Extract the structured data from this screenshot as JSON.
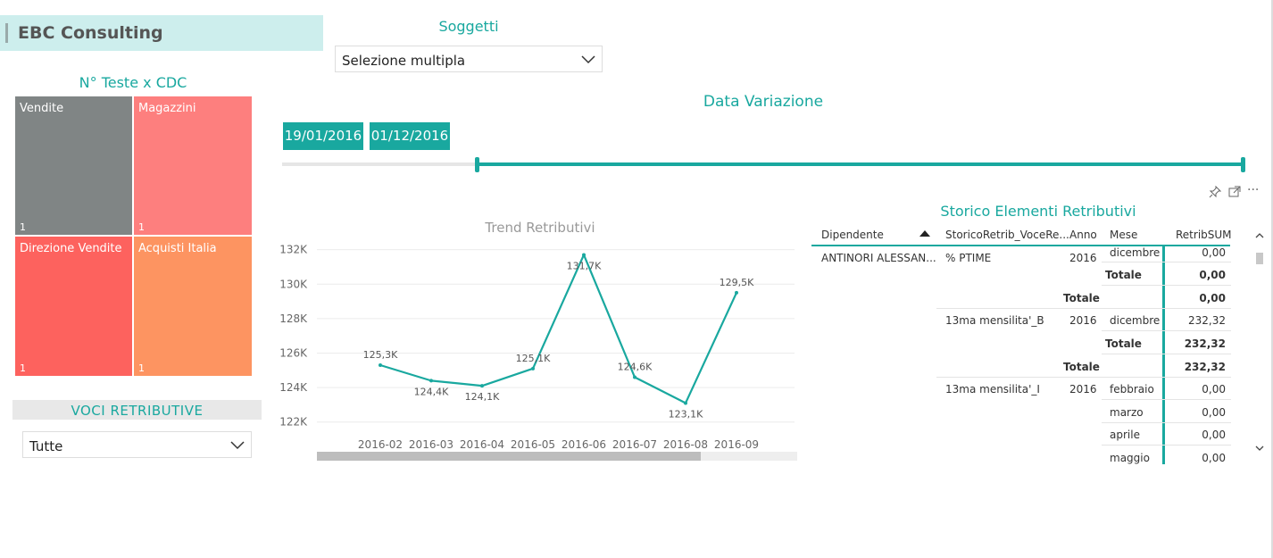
{
  "header": {
    "title": "EBC Consulting"
  },
  "treemap": {
    "title": "N° Teste x CDC",
    "tiles": [
      {
        "label": "Vendite",
        "value": "1",
        "color": "#808585"
      },
      {
        "label": "Magazzini",
        "value": "1",
        "color": "#fd7f7e"
      },
      {
        "label": "Direzione Vendite",
        "value": "1",
        "color": "#fd625e"
      },
      {
        "label": "Acquisti Italia",
        "value": "1",
        "color": "#fd9461"
      }
    ]
  },
  "voci": {
    "title": "VOCI RETRIBUTIVE",
    "value": "Tutte"
  },
  "soggetti": {
    "title": "Soggetti",
    "value": "Selezione multipla"
  },
  "date_slicer": {
    "title": "Data Variazione",
    "from": "19/01/2016",
    "to": "01/12/2016",
    "range_start_fraction": 0.2,
    "range_end_fraction": 1.0
  },
  "toolbar": {
    "pin_icon": "pin-icon",
    "focus_icon": "focus-mode-icon",
    "more_icon": "more-options-icon",
    "more_label": "···"
  },
  "chart_data": {
    "type": "line",
    "title": "Trend Retributivi",
    "categories": [
      "2016-02",
      "2016-03",
      "2016-04",
      "2016-05",
      "2016-06",
      "2016-07",
      "2016-08",
      "2016-09"
    ],
    "values": [
      125.3,
      124.4,
      124.1,
      125.1,
      131.7,
      124.6,
      123.1,
      129.5
    ],
    "data_labels": [
      "125,3K",
      "124,4K",
      "124,1K",
      "125,1K",
      "131,7K",
      "124,6K",
      "123,1K",
      "129,5K"
    ],
    "ylim": [
      121,
      132.5
    ],
    "yticks": [
      122,
      124,
      126,
      128,
      130,
      132
    ],
    "ytick_labels": [
      "122K",
      "124K",
      "126K",
      "128K",
      "130K",
      "132K"
    ],
    "grid": true,
    "color": "#19a89f"
  },
  "table": {
    "title": "Storico Elementi Retributivi",
    "columns": [
      "Dipendente",
      "StoricoRetrib_VoceRe...",
      "Anno",
      "Mese",
      "RetribSUM"
    ],
    "dipendente": "ANTINORI ALESSAN...",
    "voce1": "% PTIME",
    "voce2": "13ma mensilita'_B",
    "voce3": "13ma mensilita'_I",
    "anno": "2016",
    "totale_label": "Totale",
    "rows": [
      {
        "mese": "dicembre",
        "value": "0,00"
      },
      {
        "totale": "0,00"
      },
      {
        "totale": "0,00"
      },
      {
        "mese": "dicembre",
        "value": "232,32"
      },
      {
        "totale": "232,32"
      },
      {
        "totale": "232,32"
      },
      {
        "mese": "febbraio",
        "value": "0,00"
      },
      {
        "mese": "marzo",
        "value": "0,00"
      },
      {
        "mese": "aprile",
        "value": "0,00"
      },
      {
        "mese": "maggio",
        "value": "0,00"
      }
    ]
  }
}
